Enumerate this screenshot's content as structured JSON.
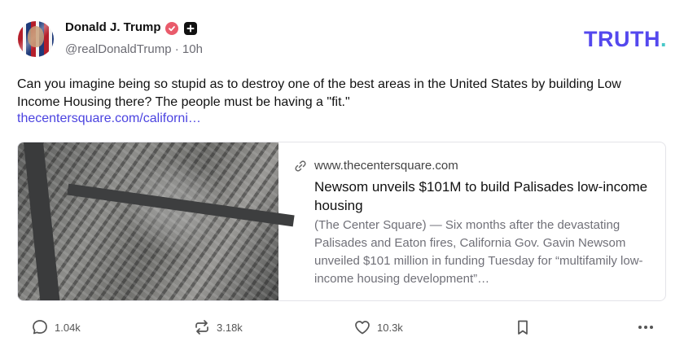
{
  "author": {
    "name": "Donald J. Trump",
    "handle": "@realDonaldTrump",
    "time": "10h"
  },
  "brand": {
    "logo_text": "TRUTH",
    "logo_dot": ".",
    "color": "#5448ee",
    "dot_color": "#47c8c8"
  },
  "post": {
    "text": "Can you imagine being so stupid as to destroy one of the best areas in the United States by building Low Income Housing there? The people must be having a \"fit.\"",
    "link": "thecentersquare.com/californi…"
  },
  "card": {
    "domain": "www.thecentersquare.com",
    "title": "Newsom unveils $101M to build Palisades low-income housing",
    "description": "(The Center Square) — Six months after the devastating Palisades and Eaton fires, California Gov. Gavin Newsom unveiled $101 million in funding Tuesday for “multifamily low-income housing development”…",
    "image_icon": "aerial-burned-neighborhood"
  },
  "actions": {
    "reply_count": "1.04k",
    "restruth_count": "3.18k",
    "like_count": "10.3k"
  },
  "icons": {
    "verified": "verified-badge-icon",
    "plus": "plus-badge-icon",
    "reply": "reply-icon",
    "restruth": "retruth-icon",
    "like": "heart-icon",
    "bookmark": "bookmark-icon",
    "more": "more-icon",
    "link": "link-icon"
  }
}
